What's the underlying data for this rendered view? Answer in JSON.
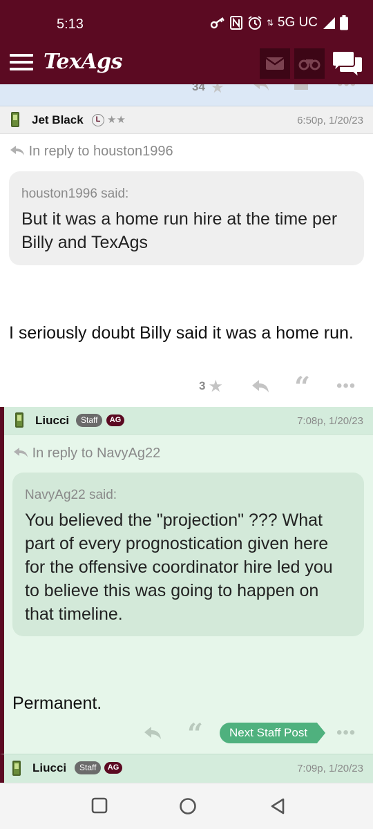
{
  "status": {
    "time": "5:13",
    "network": "5G UC"
  },
  "header": {
    "logo": "TexAgs"
  },
  "prev_post": {
    "count": "34"
  },
  "posts": [
    {
      "username": "Jet Black",
      "badge": "L",
      "stars": "★★",
      "timestamp": "6:50p, 1/20/23",
      "reply_to": "In reply to houston1996",
      "quote_head": "houston1996 said:",
      "quote_body": "But it was a home run hire at the time per Billy and TexAgs",
      "body": "I seriously doubt Billy said it was a home run.",
      "count": "3"
    },
    {
      "username": "Liucci",
      "staff": "Staff",
      "ag": "AG",
      "timestamp": "7:08p, 1/20/23",
      "reply_to": "In reply to NavyAg22",
      "quote_head": "NavyAg22 said:",
      "quote_body": "You believed the \"projection\" ??? What part of every prognostication given here for the offensive coordinator hire led you to believe this was going to happen on that timeline.",
      "body": "Permanent.",
      "next_label": "Next Staff Post"
    },
    {
      "username": "Liucci",
      "staff": "Staff",
      "ag": "AG",
      "timestamp": "7:09p, 1/20/23"
    }
  ],
  "colors": {
    "brand": "#5b0a22",
    "staff_bg": "#e6f6ea",
    "next_btn": "#4fb17e"
  }
}
